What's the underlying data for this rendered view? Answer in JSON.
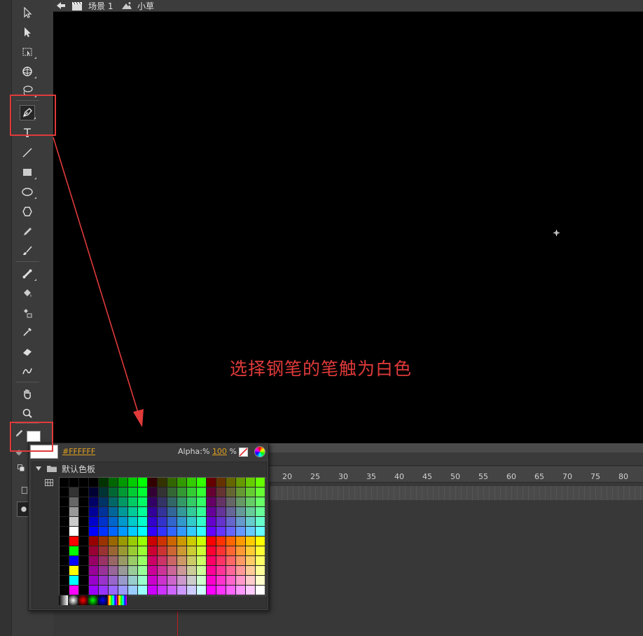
{
  "scene_bar": {
    "scene_label": "场景 1",
    "symbol_label": "小草"
  },
  "tools": [
    {
      "name": "selection-tool",
      "icon": "arrow-icon"
    },
    {
      "name": "subselection-tool",
      "icon": "subselect-arrow-icon"
    },
    {
      "name": "free-transform-tool",
      "icon": "free-transform-icon"
    },
    {
      "name": "3d-rotation-tool",
      "icon": "3d-rotation-icon"
    },
    {
      "name": "lasso-tool",
      "icon": "lasso-icon"
    },
    {
      "name": "pen-tool",
      "icon": "pen-icon",
      "active": true
    },
    {
      "name": "text-tool",
      "icon": "text-icon"
    },
    {
      "name": "line-tool",
      "icon": "line-icon"
    },
    {
      "name": "rectangle-tool",
      "icon": "rectangle-icon"
    },
    {
      "name": "oval-tool",
      "icon": "oval-icon"
    },
    {
      "name": "polystar-tool",
      "icon": "polygon-icon"
    },
    {
      "name": "pencil-tool",
      "icon": "pencil-icon"
    },
    {
      "name": "brush-tool",
      "icon": "brush-icon"
    },
    {
      "name": "bone-tool",
      "icon": "bone-icon"
    },
    {
      "name": "paint-bucket-tool",
      "icon": "paint-bucket-icon"
    },
    {
      "name": "ink-bottle-tool",
      "icon": "ink-bottle-icon"
    },
    {
      "name": "eyedropper-tool",
      "icon": "eyedropper-icon"
    },
    {
      "name": "eraser-tool",
      "icon": "eraser-icon"
    },
    {
      "name": "width-tool",
      "icon": "width-icon"
    },
    {
      "name": "hand-tool",
      "icon": "hand-icon"
    },
    {
      "name": "zoom-tool",
      "icon": "magnifier-icon"
    }
  ],
  "stroke_color": "#FFFFFF",
  "annotation_text": "选择钢笔的笔触为白色",
  "annotation_color": "#e03a3a",
  "color_popup": {
    "hex_value": "#FFFFFF",
    "alpha_label": "Alpha:%",
    "alpha_value": "100",
    "alpha_unit": "%",
    "swatch_folder": "默认色板"
  },
  "timeline": {
    "ruler_ticks": [
      "20",
      "25",
      "30",
      "35",
      "40",
      "45",
      "50",
      "55",
      "60",
      "65",
      "70",
      "75",
      "80"
    ]
  }
}
